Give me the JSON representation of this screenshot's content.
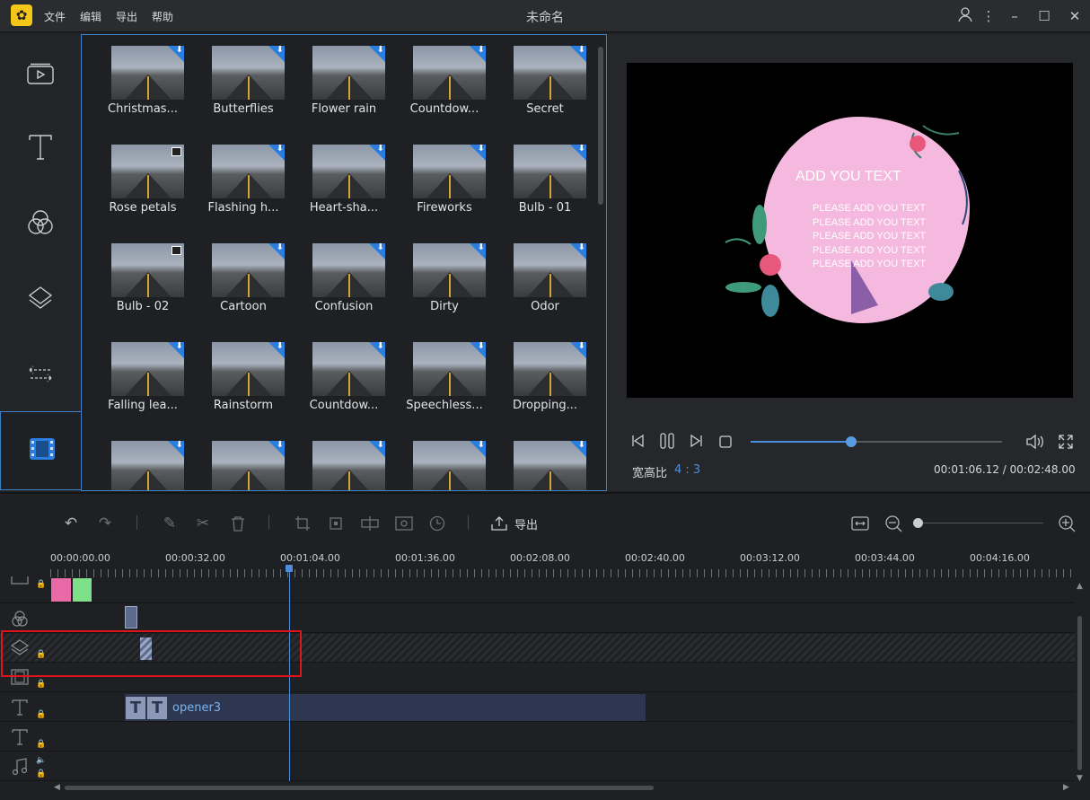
{
  "window": {
    "title": "未命名",
    "menus": [
      "文件",
      "编辑",
      "导出",
      "帮助"
    ]
  },
  "sidebar": {
    "items": [
      "media-icon",
      "text-icon",
      "filter-icon",
      "overlay-icon",
      "transition-icon",
      "element-icon"
    ],
    "active": "element-icon"
  },
  "effects": [
    {
      "label": "Christmas..."
    },
    {
      "label": "Butterflies"
    },
    {
      "label": "Flower rain"
    },
    {
      "label": "Countdow..."
    },
    {
      "label": "Secret"
    },
    {
      "label": "Rose petals"
    },
    {
      "label": "Flashing h..."
    },
    {
      "label": "Heart-sha..."
    },
    {
      "label": "Fireworks"
    },
    {
      "label": "Bulb - 01"
    },
    {
      "label": "Bulb - 02"
    },
    {
      "label": "Cartoon"
    },
    {
      "label": "Confusion"
    },
    {
      "label": "Dirty"
    },
    {
      "label": "Odor"
    },
    {
      "label": "Falling lea..."
    },
    {
      "label": "Rainstorm"
    },
    {
      "label": "Countdow..."
    },
    {
      "label": "Speechless..."
    },
    {
      "label": "Dropping..."
    },
    {
      "label": ""
    },
    {
      "label": ""
    },
    {
      "label": ""
    },
    {
      "label": ""
    },
    {
      "label": ""
    }
  ],
  "preview": {
    "heading": "ADD YOU TEXT",
    "lines": [
      "PLEASE ADD YOU TEXT",
      "PLEASE ADD YOU TEXT",
      "PLEASE ADD YOU TEXT",
      "PLEASE ADD YOU TEXT",
      "PLEASE ADD YOU TEXT"
    ],
    "aspect_label": "宽高比",
    "aspect_value": "4 : 3",
    "time": "00:01:06.12 / 00:02:48.00",
    "progress": 0.4
  },
  "toolbar": {
    "export_label": "导出"
  },
  "timeline": {
    "ticks": [
      "00:00:00.00",
      "00:00:32.00",
      "00:01:04.00",
      "00:01:36.00",
      "00:02:08.00",
      "00:02:40.00",
      "00:03:12.00",
      "00:03:44.00",
      "00:04:16.00"
    ],
    "text_clip": "opener3"
  },
  "colors": {
    "accent": "#4b8fdc",
    "highlight": "#e0141b"
  }
}
